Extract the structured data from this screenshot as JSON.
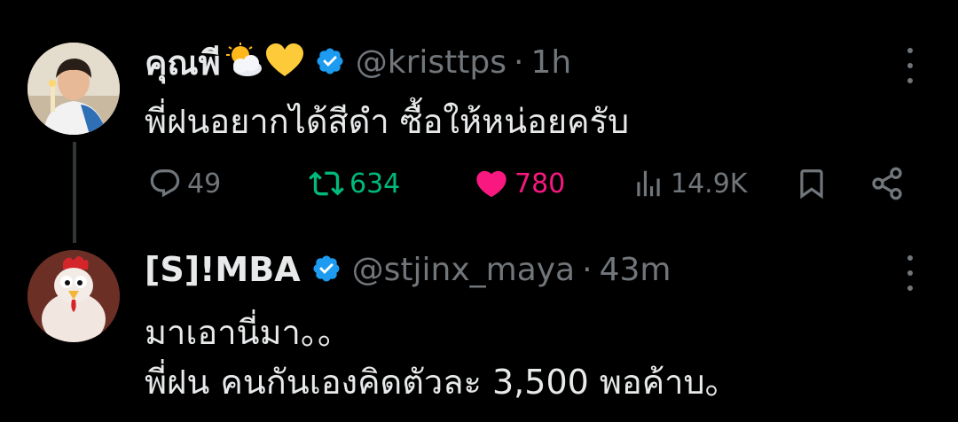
{
  "tweets": [
    {
      "display_name": "คุณพี",
      "emojis": [
        "sun-behind-cloud",
        "yellow-heart"
      ],
      "verified": true,
      "handle": "@kristtps",
      "separator": "·",
      "time": "1h",
      "text_lines": [
        "พี่ฝนอยากได้สีดำ ซื้อให้หน่อยครับ"
      ],
      "stats": {
        "replies": "49",
        "retweets": "634",
        "likes": "780",
        "views": "14.9K"
      },
      "liked": true
    },
    {
      "display_name": "[S]!MBA",
      "verified": true,
      "handle": "@stjinx_maya",
      "separator": "·",
      "time": "43m",
      "text_lines": [
        "มาเอานี่มา。。",
        "พี่ฝน คนกันเองคิดตัวละ 3,500 พอค้าบ。"
      ]
    }
  ],
  "colors": {
    "background": "#000000",
    "text": "#e7e9ea",
    "muted": "#71767b",
    "verified": "#1d9bf0",
    "retweet": "#00ba7c",
    "like": "#f91880",
    "thread_line": "#333639"
  }
}
